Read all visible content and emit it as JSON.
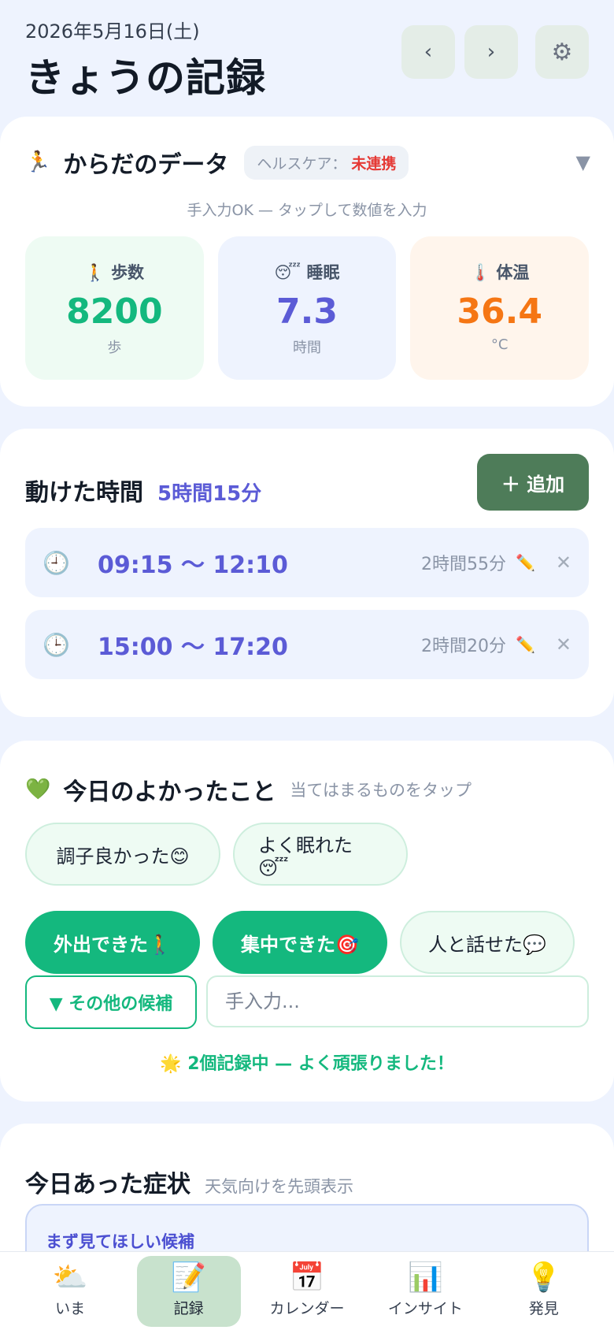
{
  "header": {
    "date": "2026年5月16日(土)",
    "title": "きょうの記録",
    "prev_label": "‹",
    "next_label": "›",
    "settings_icon": "gear-icon"
  },
  "body_data": {
    "emoji": "🏃",
    "title": "からだのデータ",
    "healthcare_label": "ヘルスケア：",
    "healthcare_status": "未連携",
    "collapse_icon": "▼",
    "hint": "手入力OK — タップして数値を入力",
    "metrics": [
      {
        "emoji": "🚶",
        "label": "歩数",
        "value": "8200",
        "unit": "歩"
      },
      {
        "emoji": "😴",
        "label": "睡眠",
        "value": "7.3",
        "unit": "時間"
      },
      {
        "emoji": "🌡️",
        "label": "体温",
        "value": "36.4",
        "unit": "°C"
      }
    ]
  },
  "activity": {
    "title": "動けた時間",
    "total": "5時間15分",
    "add_label": "＋ 追加",
    "entries": [
      {
        "range": "09:15 〜 12:10",
        "duration": "2時間55分"
      },
      {
        "range": "15:00 〜 17:20",
        "duration": "2時間20分"
      }
    ]
  },
  "good_things": {
    "emoji": "💚",
    "title": "今日のよかったこと",
    "subtitle": "当てはまるものをタップ",
    "chips": [
      {
        "label": "調子良かった😊",
        "selected": false
      },
      {
        "label": "よく眠れた😴",
        "selected": false
      },
      {
        "label": "外出できた🚶",
        "selected": true
      },
      {
        "label": "集中できた🎯",
        "selected": true
      },
      {
        "label": "人と話せた💬",
        "selected": false
      }
    ],
    "more_label": "▼ その他の候補",
    "input_placeholder": "手入力...",
    "note": "🌟  2個記録中 — よく頑張りました！"
  },
  "symptoms": {
    "title": "今日あった症状",
    "subtitle": "天気向けを先頭表示",
    "box_label": "まず見てほしい候補"
  },
  "nav": [
    {
      "icon": "⛅",
      "label": "いま",
      "active": false
    },
    {
      "icon": "📝",
      "label": "記録",
      "active": true
    },
    {
      "icon": "📅",
      "label": "カレンダー",
      "active": false
    },
    {
      "icon": "📊",
      "label": "インサイト",
      "active": false
    },
    {
      "icon": "💡",
      "label": "発見",
      "active": false
    }
  ],
  "colors": {
    "accent_green": "#14b87e",
    "accent_indigo": "#5b5bd6",
    "accent_orange": "#f57614",
    "button_green": "#4e7c59",
    "alert_red": "#e53935"
  }
}
